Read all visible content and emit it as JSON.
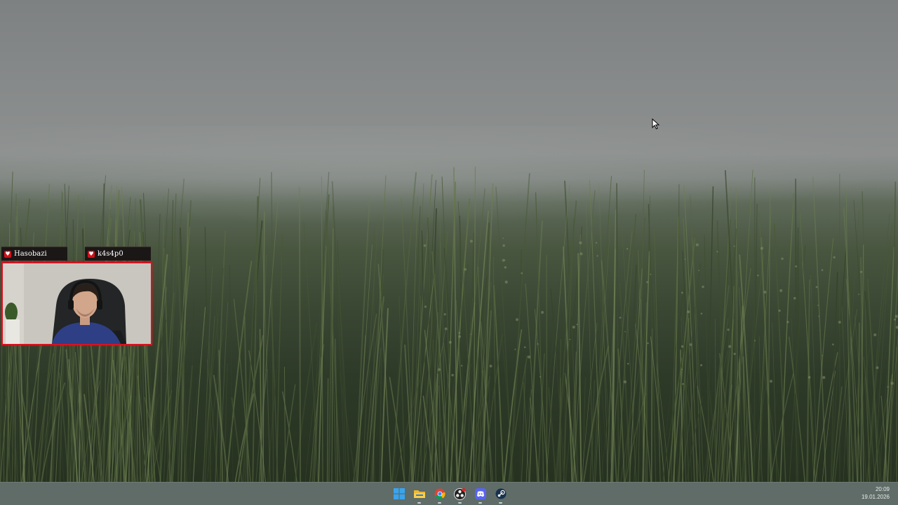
{
  "overlay": {
    "tag_left": "Hasobazi",
    "tag_right": "k4s4p0",
    "accent_color": "#d51420"
  },
  "taskbar": {
    "pinned": [
      {
        "name": "start",
        "icon": "windows-icon"
      },
      {
        "name": "file-explorer",
        "icon": "folder-icon"
      },
      {
        "name": "chrome",
        "icon": "chrome-icon"
      },
      {
        "name": "obs",
        "icon": "obs-icon"
      },
      {
        "name": "discord",
        "icon": "discord-icon"
      },
      {
        "name": "steam",
        "icon": "steam-icon"
      }
    ],
    "time": "20:09",
    "date": "19.01.2026"
  },
  "wallpaper": {
    "theme": "foggy grass field"
  }
}
